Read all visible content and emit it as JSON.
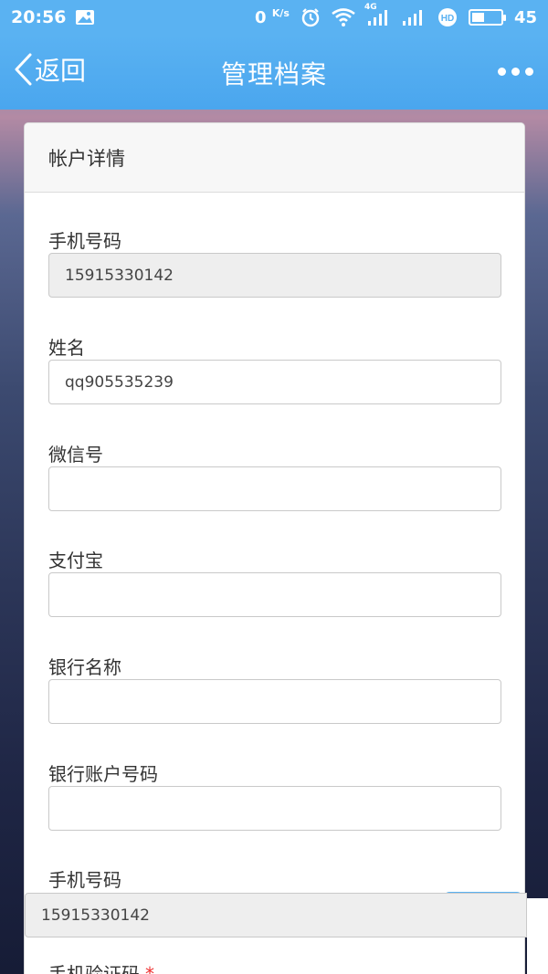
{
  "status_bar": {
    "time": "20:56",
    "network_speed": "0",
    "network_speed_unit": "K/s",
    "network_type": "4G",
    "battery": "45",
    "battery_level": 0.45
  },
  "nav": {
    "back_label": "返回",
    "title": "管理档案"
  },
  "card": {
    "header": "帐户详情",
    "fields": [
      {
        "label": "手机号码",
        "value": "15915330142",
        "readonly": true
      },
      {
        "label": "姓名",
        "value": "qq905535239",
        "readonly": false
      },
      {
        "label": "微信号",
        "value": "",
        "readonly": false
      },
      {
        "label": "支付宝",
        "value": "",
        "readonly": false
      },
      {
        "label": "银行名称",
        "value": "",
        "readonly": false
      },
      {
        "label": "银行账户号码",
        "value": "",
        "readonly": false
      },
      {
        "label": "手机号码",
        "value": "15915330142",
        "readonly": true
      }
    ],
    "verify_label": "手机验证码",
    "required_mark": "*"
  },
  "colors": {
    "accent": "#5ab2f2",
    "readonly_bg": "#eeeeee",
    "required": "#e33333"
  }
}
